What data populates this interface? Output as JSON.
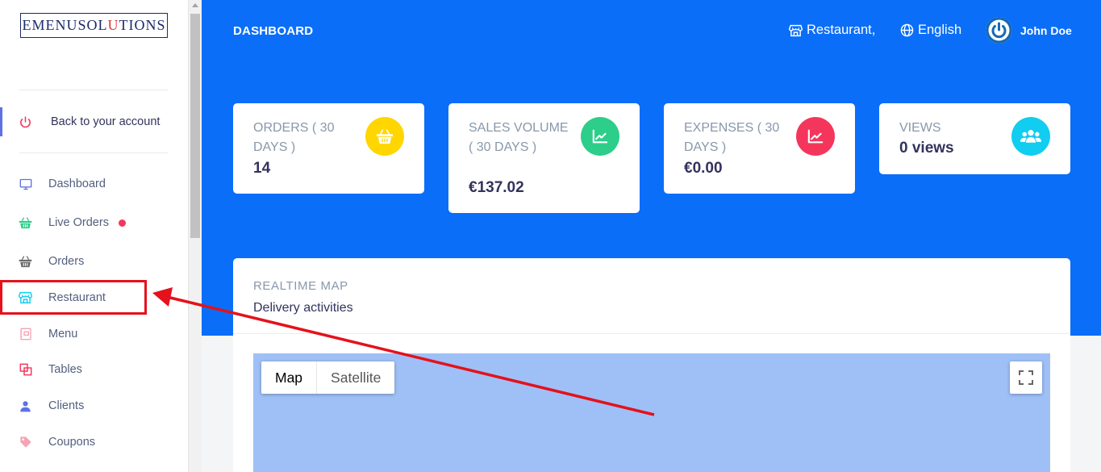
{
  "brand": {
    "logo_left": "EMENUSOL",
    "logo_highlight": "U",
    "logo_right": "TIONS"
  },
  "sidebar": {
    "back_label": "Back to your account",
    "items": [
      {
        "label": "Dashboard",
        "icon": "monitor-icon"
      },
      {
        "label": "Live Orders",
        "icon": "basket-icon",
        "has_dot": true
      },
      {
        "label": "Orders",
        "icon": "basket-icon"
      },
      {
        "label": "Restaurant",
        "icon": "store-icon"
      },
      {
        "label": "Menu",
        "icon": "menu-book-icon"
      },
      {
        "label": "Tables",
        "icon": "tables-icon"
      },
      {
        "label": "Clients",
        "icon": "user-icon"
      },
      {
        "label": "Coupons",
        "icon": "tag-icon"
      }
    ]
  },
  "header": {
    "title": "DASHBOARD",
    "restaurant_label": "Restaurant,",
    "language_label": "English",
    "user_name": "John Doe"
  },
  "stats": [
    {
      "title": "ORDERS ( 30 DAYS )",
      "value": "14",
      "icon": "basket-icon",
      "color": "#ffd600"
    },
    {
      "title": "SALES VOLUME ( 30 DAYS )",
      "value": "€137.02",
      "icon": "chart-line-icon",
      "color": "#2dce89"
    },
    {
      "title": "EXPENSES ( 30 DAYS )",
      "value": "€0.00",
      "icon": "chart-line-icon",
      "color": "#f5365c"
    },
    {
      "title": "VIEWS",
      "value": "0 views",
      "icon": "users-icon",
      "color": "#11cdef"
    }
  ],
  "map": {
    "subtitle": "REALTIME MAP",
    "title": "Delivery activities",
    "map_button": "Map",
    "satellite_button": "Satellite"
  },
  "colors": {
    "header_bg": "#0a6ef9",
    "accent": "#5e72e4",
    "annotation": "#e5111b",
    "map_water": "#9ec0f6"
  }
}
